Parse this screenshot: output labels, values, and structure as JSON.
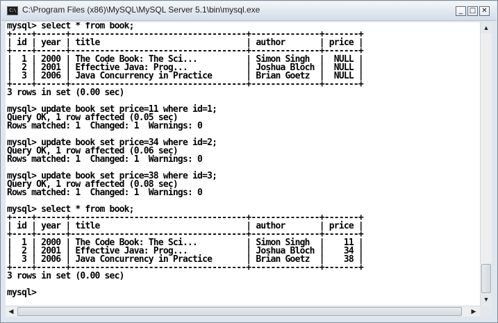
{
  "window": {
    "title": "C:\\Program Files (x86)\\MySQL\\MySQL Server 5.1\\bin\\mysql.exe",
    "icon_label": "C:\\",
    "controls": {
      "minimize": "_",
      "maximize": "□",
      "close": "✕"
    }
  },
  "console": {
    "lines": [
      "mysql> select * from book;",
      "+----+------+------------------------------------+--------------+-------+",
      "| id | year | title                              | author       | price |",
      "+----+------+------------------------------------+--------------+-------+",
      "|  1 | 2000 | The Code Book: The Sci...          | Simon Singh  |  NULL |",
      "|  2 | 2001 | Effective Java: Prog...            | Joshua Bloch |  NULL |",
      "|  3 | 2006 | Java Concurrency in Practice       | Brian Goetz  |  NULL |",
      "+----+------+------------------------------------+--------------+-------+",
      "3 rows in set (0.00 sec)",
      "",
      "mysql> update book set price=11 where id=1;",
      "Query OK, 1 row affected (0.05 sec)",
      "Rows matched: 1  Changed: 1  Warnings: 0",
      "",
      "mysql> update book set price=34 where id=2;",
      "Query OK, 1 row affected (0.06 sec)",
      "Rows matched: 1  Changed: 1  Warnings: 0",
      "",
      "mysql> update book set price=38 where id=3;",
      "Query OK, 1 row affected (0.08 sec)",
      "Rows matched: 1  Changed: 1  Warnings: 0",
      "",
      "mysql> select * from book;",
      "+----+------+------------------------------------+--------------+-------+",
      "| id | year | title                              | author       | price |",
      "+----+------+------------------------------------+--------------+-------+",
      "|  1 | 2000 | The Code Book: The Sci...          | Simon Singh  |    11 |",
      "|  2 | 2001 | Effective Java: Prog...            | Joshua Bloch |    34 |",
      "|  3 | 2006 | Java Concurrency in Practice       | Brian Goetz  |    38 |",
      "+----+------+------------------------------------+--------------+-------+",
      "3 rows in set (0.00 sec)",
      "",
      "mysql>"
    ]
  },
  "scrollbar": {
    "up_arrow": "▲",
    "down_arrow": "▼",
    "left_arrow": "◀",
    "right_arrow": "▶"
  }
}
